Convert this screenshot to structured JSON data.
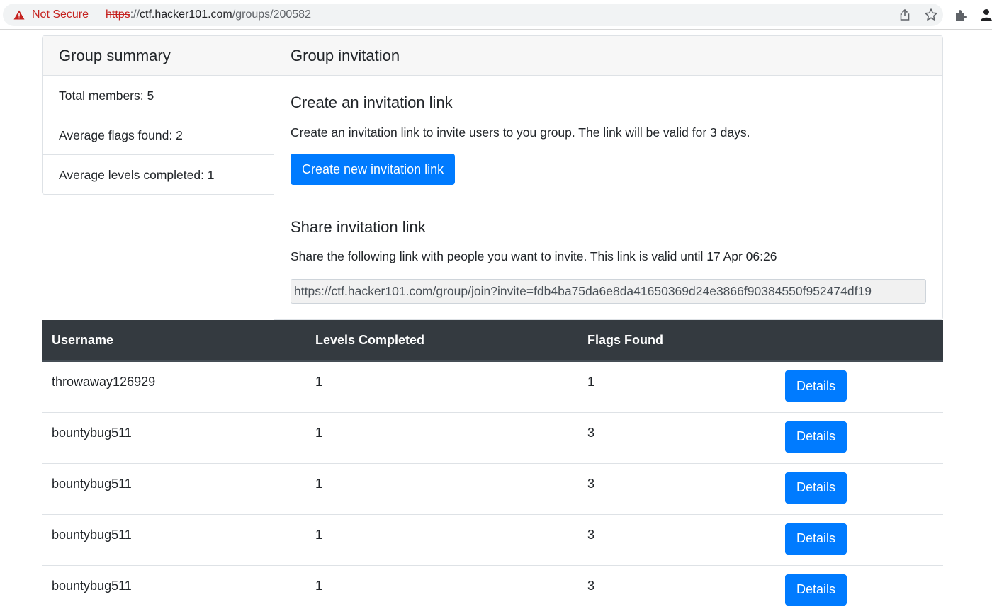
{
  "browser": {
    "security_label": "Not Secure",
    "url_scheme": "https",
    "url_host": "ctf.hacker101.com",
    "url_path": "/groups/200582"
  },
  "summary": {
    "title": "Group summary",
    "items": [
      {
        "label": "Total members: 5"
      },
      {
        "label": "Average flags found: 2"
      },
      {
        "label": "Average levels completed: 1"
      }
    ]
  },
  "invitation": {
    "title": "Group invitation",
    "create_heading": "Create an invitation link",
    "create_desc": "Create an invitation link to invite users to you group. The link will be valid for 3 days.",
    "create_button": "Create new invitation link",
    "share_heading": "Share invitation link",
    "share_desc": "Share the following link with people you want to invite. This link is valid until 17 Apr 06:26",
    "link_value": "https://ctf.hacker101.com/group/join?invite=fdb4ba75da6e8da41650369d24e3866f90384550f952474df19"
  },
  "table": {
    "columns": [
      "Username",
      "Levels Completed",
      "Flags Found",
      ""
    ],
    "rows": [
      {
        "username": "throwaway126929",
        "levels": "1",
        "flags": "1",
        "action": "Details"
      },
      {
        "username": "bountybug511",
        "levels": "1",
        "flags": "3",
        "action": "Details"
      },
      {
        "username": "bountybug511",
        "levels": "1",
        "flags": "3",
        "action": "Details"
      },
      {
        "username": "bountybug511",
        "levels": "1",
        "flags": "3",
        "action": "Details"
      },
      {
        "username": "bountybug511",
        "levels": "1",
        "flags": "3",
        "action": "Details"
      }
    ]
  },
  "colors": {
    "primary": "#007bff",
    "table_header": "#343a40",
    "not_secure": "#c5221f"
  },
  "icons": [
    "warning-icon",
    "share-icon",
    "bookmark-star-icon",
    "extensions-icon",
    "profile-icon"
  ]
}
